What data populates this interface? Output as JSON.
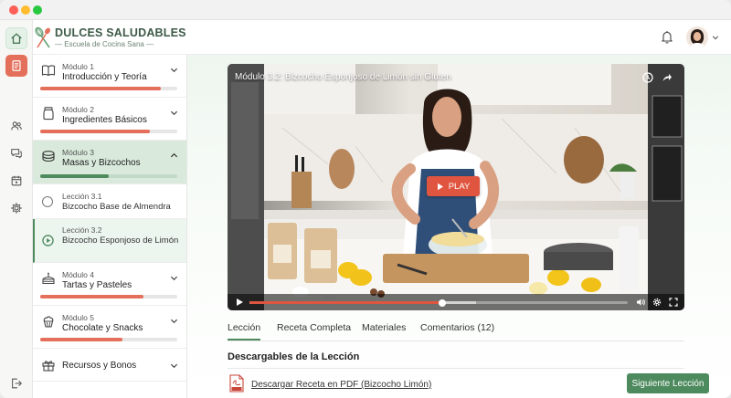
{
  "brand": {
    "title": "DULCES SALUDABLES",
    "subtitle": "Escuela de Cocina Sana"
  },
  "rail": [
    {
      "icon": "home-icon"
    },
    {
      "icon": "lessons-icon"
    },
    {
      "icon": "community-icon"
    },
    {
      "icon": "chat-icon"
    },
    {
      "icon": "calendar-icon"
    },
    {
      "icon": "settings-icon"
    },
    {
      "icon": "logout-icon"
    }
  ],
  "modules": [
    {
      "kicker": "Módulo 1",
      "title": "Introducción y Teoría",
      "progress": 0.88,
      "icon": "book-icon"
    },
    {
      "kicker": "Módulo 2",
      "title": "Ingredientes Básicos",
      "progress": 0.8,
      "icon": "jar-icon"
    },
    {
      "kicker": "Módulo 3",
      "title": "Masas y Bizcochos",
      "progress": 0.5,
      "icon": "cake-layers-icon"
    },
    {
      "kicker": "Módulo 4",
      "title": "Tartas y Pasteles",
      "progress": 0.75,
      "icon": "cake-icon"
    },
    {
      "kicker": "Módulo 5",
      "title": "Chocolate y Snacks",
      "progress": 0.6,
      "icon": "cupcake-icon"
    }
  ],
  "lessons": [
    {
      "kicker": "Lección 3.1",
      "title": "Bizcocho Base de Almendra"
    },
    {
      "kicker": "Lección 3.2",
      "title": "Bizcocho Esponjoso de Limón"
    }
  ],
  "resources": {
    "label": "Recursos y Bonos"
  },
  "video": {
    "title": "Módulo 3.2: Bizcocho Esponjoso de Limón sin Gluten",
    "play_label": "PLAY",
    "played": 0.51,
    "buffered": 0.6
  },
  "tabs": [
    "Lección",
    "Receta Completa",
    "Materiales",
    "Comentarios (12)"
  ],
  "downloads": {
    "heading": "Descargables de la Lección",
    "pdf_link": "Descargar Receta en PDF (Bizcocho Limón)"
  },
  "next_button": "Siguiente Lección",
  "colors": {
    "accent": "#4d8a5d",
    "coral": "#e46f5a",
    "play": "#e0553f"
  }
}
